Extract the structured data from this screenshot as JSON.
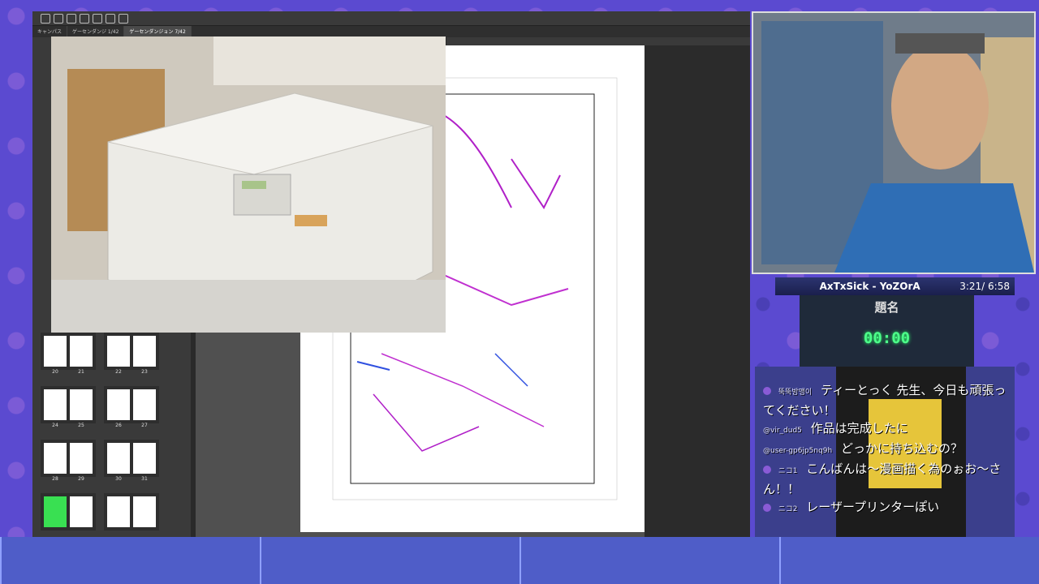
{
  "app": {
    "tabs": [
      "キャンパス",
      "ゲーセンダンジ 1/42",
      "ゲーセンダンジョン 7/42"
    ]
  },
  "thumbnails": {
    "rows": [
      {
        "left_pages": [
          "20",
          "21"
        ],
        "right_pages": [
          "22",
          "23"
        ]
      },
      {
        "left_pages": [
          "24",
          "25"
        ],
        "right_pages": [
          "26",
          "27"
        ]
      },
      {
        "left_pages": [
          "28",
          "29"
        ],
        "right_pages": [
          "30",
          "31"
        ]
      },
      {
        "left_pages": [
          "",
          ""
        ],
        "right_pages": [
          "",
          ""
        ]
      }
    ]
  },
  "stream": {
    "song_title": "AxTxSick - YoZOrA",
    "song_time": "3:21/ 6:58",
    "timer_label": "題名",
    "timer_value": "00:00"
  },
  "chat": [
    {
      "author": "뚝뚝방맹이",
      "text": "ティーとっく 先生、今日も頑張ってください！"
    },
    {
      "author": "@vir_dud5",
      "text": "作品は完成したに"
    },
    {
      "author": "@user-gp6jp5nq9h",
      "text": "どっかに持ち込むの？"
    },
    {
      "author": "ニコ1",
      "text": "こんばんは〜漫画描く為のぉお〜さん！！"
    },
    {
      "author": "ニコ2",
      "text": "レーザープリンターぽい"
    }
  ],
  "colors": {
    "accent": "#5b4ad0",
    "timer": "#4dff8a"
  }
}
